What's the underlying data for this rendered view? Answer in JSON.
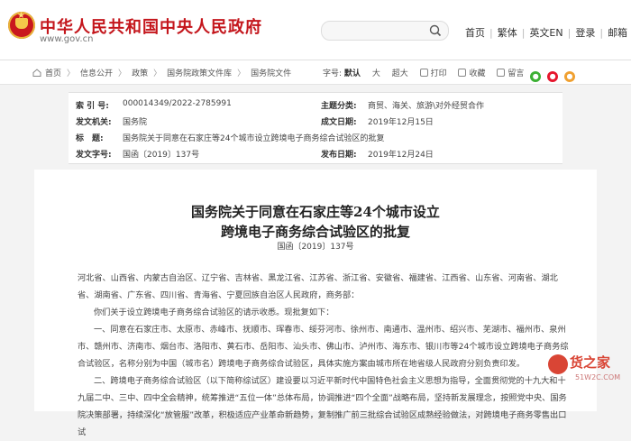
{
  "header": {
    "site_name": "中华人民共和国中央人民政府",
    "site_url": "www.gov.cn",
    "nav": [
      "首页",
      "繁体",
      "英文EN",
      "登录",
      "邮箱"
    ]
  },
  "breadcrumb": {
    "items": [
      "首页",
      "信息公开",
      "政策",
      "国务院政策文件库",
      "国务院文件"
    ]
  },
  "tools": {
    "font_label": "字号:",
    "font_options": [
      "默认",
      "大",
      "超大"
    ],
    "print": "打印",
    "favorite": "收藏",
    "message": "留言"
  },
  "meta": {
    "index_label": "索 引 号:",
    "index_value": "000014349/2022-2785991",
    "topic_label": "主题分类:",
    "topic_value": "商贸、海关、旅游\\对外经贸合作",
    "issuer_label": "发文机关:",
    "issuer_value": "国务院",
    "written_label": "成文日期:",
    "written_value": "2019年12月15日",
    "title_label": "标　题:",
    "title_value": "国务院关于同意在石家庄等24个城市设立跨境电子商务综合试验区的批复",
    "doc_no_label": "发文字号:",
    "doc_no_value": "国函〔2019〕137号",
    "pub_label": "发布日期:",
    "pub_value": "2019年12月24日"
  },
  "document": {
    "title_line1": "国务院关于同意在石家庄等24个城市设立",
    "title_line2": "跨境电子商务综合试验区的批复",
    "doc_number": "国函〔2019〕137号",
    "p1": "河北省、山西省、内蒙古自治区、辽宁省、吉林省、黑龙江省、江苏省、浙江省、安徽省、福建省、江西省、山东省、河南省、湖北省、湖南省、广东省、四川省、青海省、宁夏回族自治区人民政府，商务部：",
    "p2": "你们关于设立跨境电子商务综合试验区的请示收悉。现批复如下：",
    "p3": "一、同意在石家庄市、太原市、赤峰市、抚顺市、珲春市、绥芬河市、徐州市、南通市、温州市、绍兴市、芜湖市、福州市、泉州市、赣州市、济南市、烟台市、洛阳市、黄石市、岳阳市、汕头市、佛山市、泸州市、海东市、银川市等24个城市设立跨境电子商务综合试验区，名称分别为中国（城市名）跨境电子商务综合试验区，具体实施方案由城市所在地省级人民政府分别负责印发。",
    "p4": "二、跨境电子商务综合试验区（以下简称综试区）建设要以习近平新时代中国特色社会主义思想为指导，全面贯彻党的十九大和十九届二中、三中、四中全会精神，统筹推进“五位一体”总体布局，协调推进“四个全面”战略布局，坚持新发展理念，按照党中央、国务院决策部署，持续深化“放管服”改革，积极适应产业革命新趋势，复制推广前三批综合试验区成熟经验做法，对跨境电子商务零售出口试"
  },
  "watermark": {
    "text": "货之家",
    "sub": "51W2C.COM"
  },
  "colors": {
    "brand_red": "#c4161c",
    "watermark_red": "#d94535"
  }
}
